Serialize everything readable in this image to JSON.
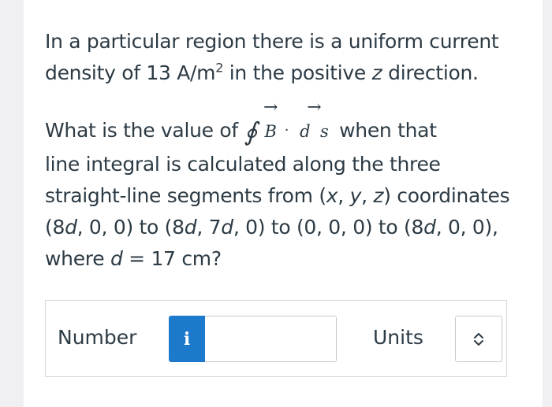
{
  "question": {
    "p1_line1": "In a particular region there is a uniform current",
    "p1_line2_prefix": "density of 13 A/m",
    "p1_superscript": "2",
    "p1_line2_mid": " in the positive ",
    "p1_var_z": "z",
    "p1_line2_suffix": " direction.",
    "p2_prefix": "What is the value of ",
    "integral_symbol": "∮",
    "vec_B": "B",
    "vec_arrow": "→",
    "dot_op": "·",
    "vec_d": "d",
    "vec_s": "s",
    "p2_after_integral": " when that",
    "p2_line2": "line integral is calculated along the three",
    "p2_line3_prefix": "straight-line segments from (",
    "p2_x": "x",
    "p2_comma1": ", ",
    "p2_y": "y",
    "p2_comma2": ", ",
    "p2_z": "z",
    "p2_line3_suffix": ") coordinates",
    "p2_line4_a": "(8",
    "p2_line4_d1": "d",
    "p2_line4_b": ", 0, 0) to (8",
    "p2_line4_d2": "d",
    "p2_line4_c": ", 7",
    "p2_line4_d3": "d",
    "p2_line4_e": ", 0) to (0, 0, 0) to (8",
    "p2_line4_d4": "d",
    "p2_line4_f": ", 0, 0),",
    "p2_line5_prefix": "where ",
    "p2_line5_d": "d",
    "p2_line5_suffix": " = 17 cm?"
  },
  "answer": {
    "number_label": "Number",
    "info_button_label": "i",
    "number_value": "",
    "units_label": "Units",
    "units_selected": ""
  },
  "colors": {
    "info_button": "#1d79cc",
    "text": "#2d3b45",
    "background": "#f0f0f2"
  }
}
